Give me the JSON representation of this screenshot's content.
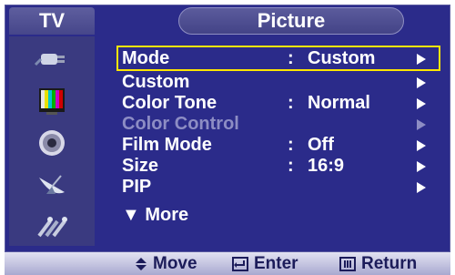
{
  "tab": {
    "label": "TV"
  },
  "header": {
    "title": "Picture"
  },
  "sidebar": {
    "items": [
      {
        "icon": "input-plug-icon"
      },
      {
        "icon": "picture-color-bars-icon"
      },
      {
        "icon": "sound-speaker-icon"
      },
      {
        "icon": "channel-satellite-dish-icon"
      },
      {
        "icon": "setup-tools-icon"
      }
    ]
  },
  "menu": {
    "rows": [
      {
        "label": "Mode",
        "colon": ":",
        "value": "Custom",
        "selected": true
      },
      {
        "label": "Custom",
        "colon": "",
        "value": ""
      },
      {
        "label": "Color Tone",
        "colon": ":",
        "value": "Normal"
      },
      {
        "label": "Color Control",
        "colon": "",
        "value": "",
        "disabled": true
      },
      {
        "label": "Film Mode",
        "colon": ":",
        "value": "Off"
      },
      {
        "label": "Size",
        "colon": ":",
        "value": "16:9"
      },
      {
        "label": "PIP",
        "colon": "",
        "value": ""
      },
      {
        "label": "▼ More",
        "colon": "",
        "value": ""
      }
    ]
  },
  "footer": {
    "move_label": "Move",
    "enter_label": "Enter",
    "return_label": "Return"
  },
  "colors": {
    "background": "#2b2b8a",
    "highlight": "#ffe600",
    "disabled_text": "#8d8dc4",
    "footer_text": "#1c1c5a"
  }
}
